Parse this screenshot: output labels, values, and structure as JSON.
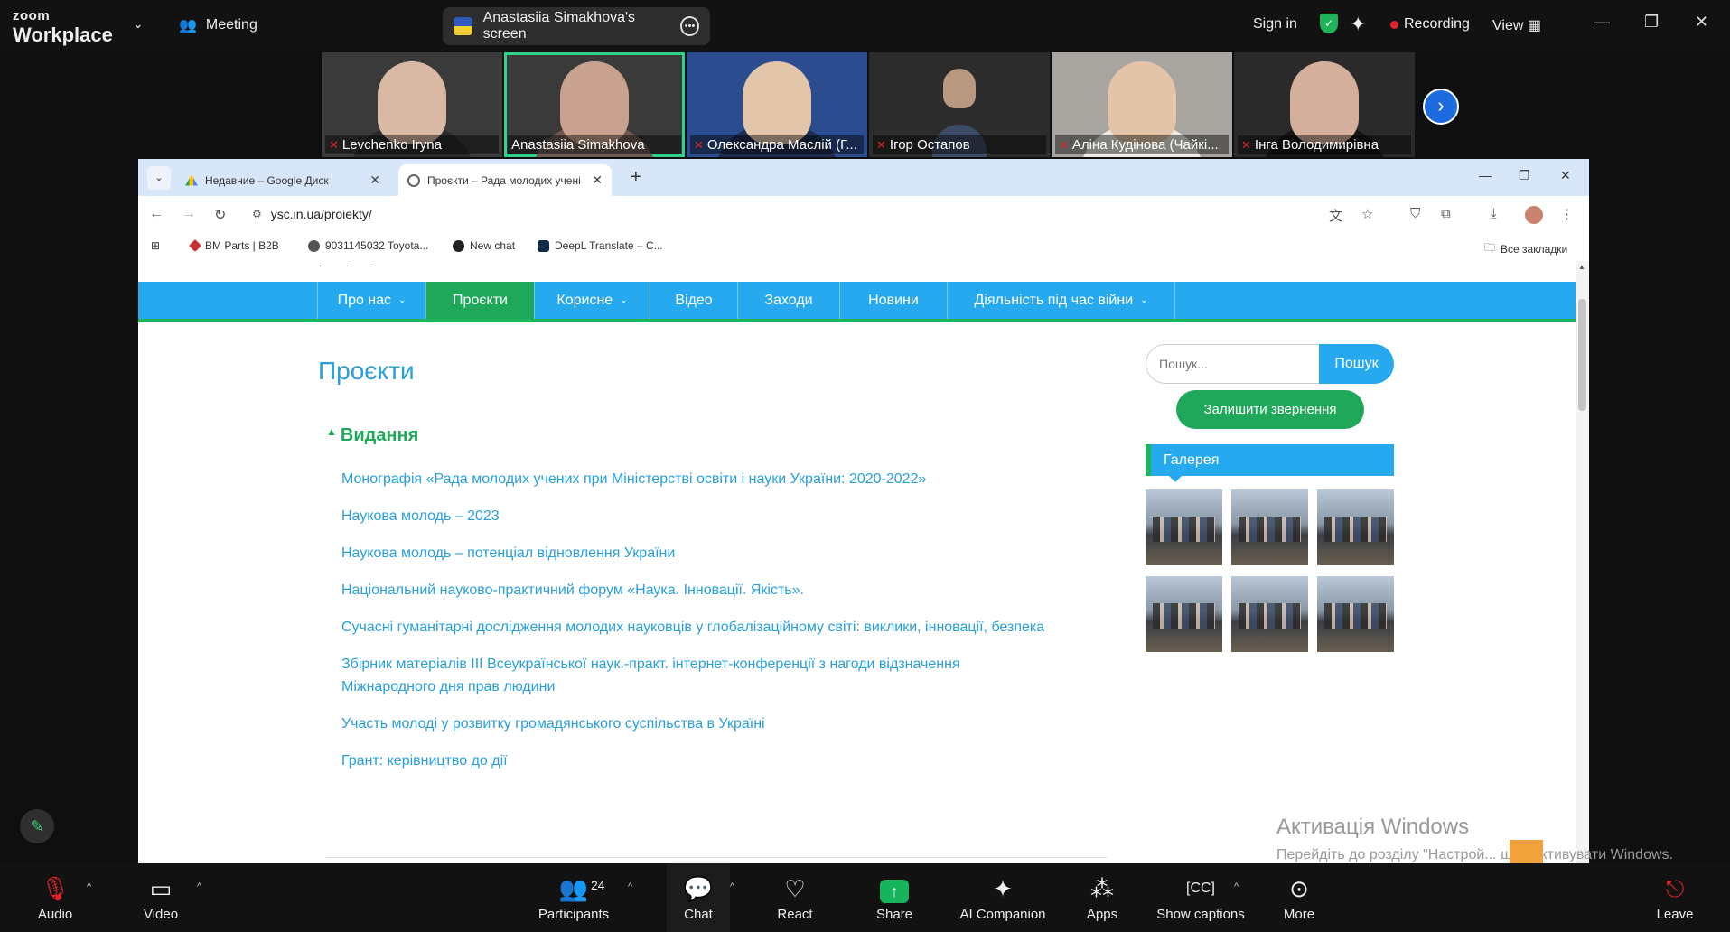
{
  "zoom": {
    "logo_small": "zoom",
    "logo_big": "Workplace",
    "meeting_label": "Meeting",
    "screen_label": "Anastasiia Simakhova's screen",
    "sign_in": "Sign in",
    "recording": "Recording",
    "view": "View"
  },
  "participants": [
    {
      "name": "Levchenko Iryna",
      "muted": true
    },
    {
      "name": "Anastasiia Simakhova",
      "muted": false
    },
    {
      "name": "Олександра Маслій (Г...",
      "muted": true
    },
    {
      "name": "Ігор Остапов",
      "muted": true
    },
    {
      "name": "Аліна Кудінова (Чайкі...",
      "muted": true
    },
    {
      "name": "Інга Володимирівна",
      "muted": true
    }
  ],
  "browser": {
    "tab1": "Недавние – Google Диск",
    "tab2": "Проєкти – Рада молодих учені",
    "url": "ysc.in.ua/proiekty/",
    "bookmarks": [
      "BM Parts | B2B",
      "9031145032 Toyota...",
      "New chat",
      "DeepL Translate – C..."
    ],
    "all_bookmarks": "Все закладки"
  },
  "site": {
    "nav": [
      "Про нас",
      "Проєкти",
      "Корисне",
      "Відео",
      "Заходи",
      "Новини",
      "Діяльність під час війни"
    ],
    "page_title": "Проєкти",
    "section_title": "Видання",
    "items": [
      "Монографія «Рада молодих учених при Міністерстві освіти і науки України: 2020-2022»",
      "Наукова молодь – 2023",
      "Наукова молодь – потенціал відновлення України",
      "Національний науково-практичний форум «Наука. Інновації. Якість».",
      "Сучасні гуманітарні дослідження молодих науковців у глобалізаційному світі: виклики, інновації, безпека",
      "Збірник матеріалів ІІІ Всеукраїнської наук.-практ. інтернет-конференції з нагоди відзначення",
      "Міжнародного дня прав людини",
      "Участь молоді у розвитку громадянського суспільства в Україні",
      "Грант: керівництво до дії"
    ],
    "search_placeholder": "Пошук...",
    "search_button": "Пошук",
    "contact_button": "Залишити звернення",
    "gallery_title": "Галерея"
  },
  "windows": {
    "activation_title": "Активація Windows",
    "activation_text": "Перейдіть до розділу \"Настрой... щоб активувати Windows."
  },
  "toolbar": {
    "audio": "Audio",
    "video": "Video",
    "participants": "Participants",
    "participants_count": "24",
    "chat": "Chat",
    "react": "React",
    "share": "Share",
    "ai_companion": "AI Companion",
    "apps": "Apps",
    "captions": "Show captions",
    "more": "More",
    "leave": "Leave"
  },
  "colors": {
    "site_blue": "#27a9ef",
    "site_green": "#1fa85a",
    "link_blue": "#27a0dd",
    "zoom_bg": "#121212"
  }
}
